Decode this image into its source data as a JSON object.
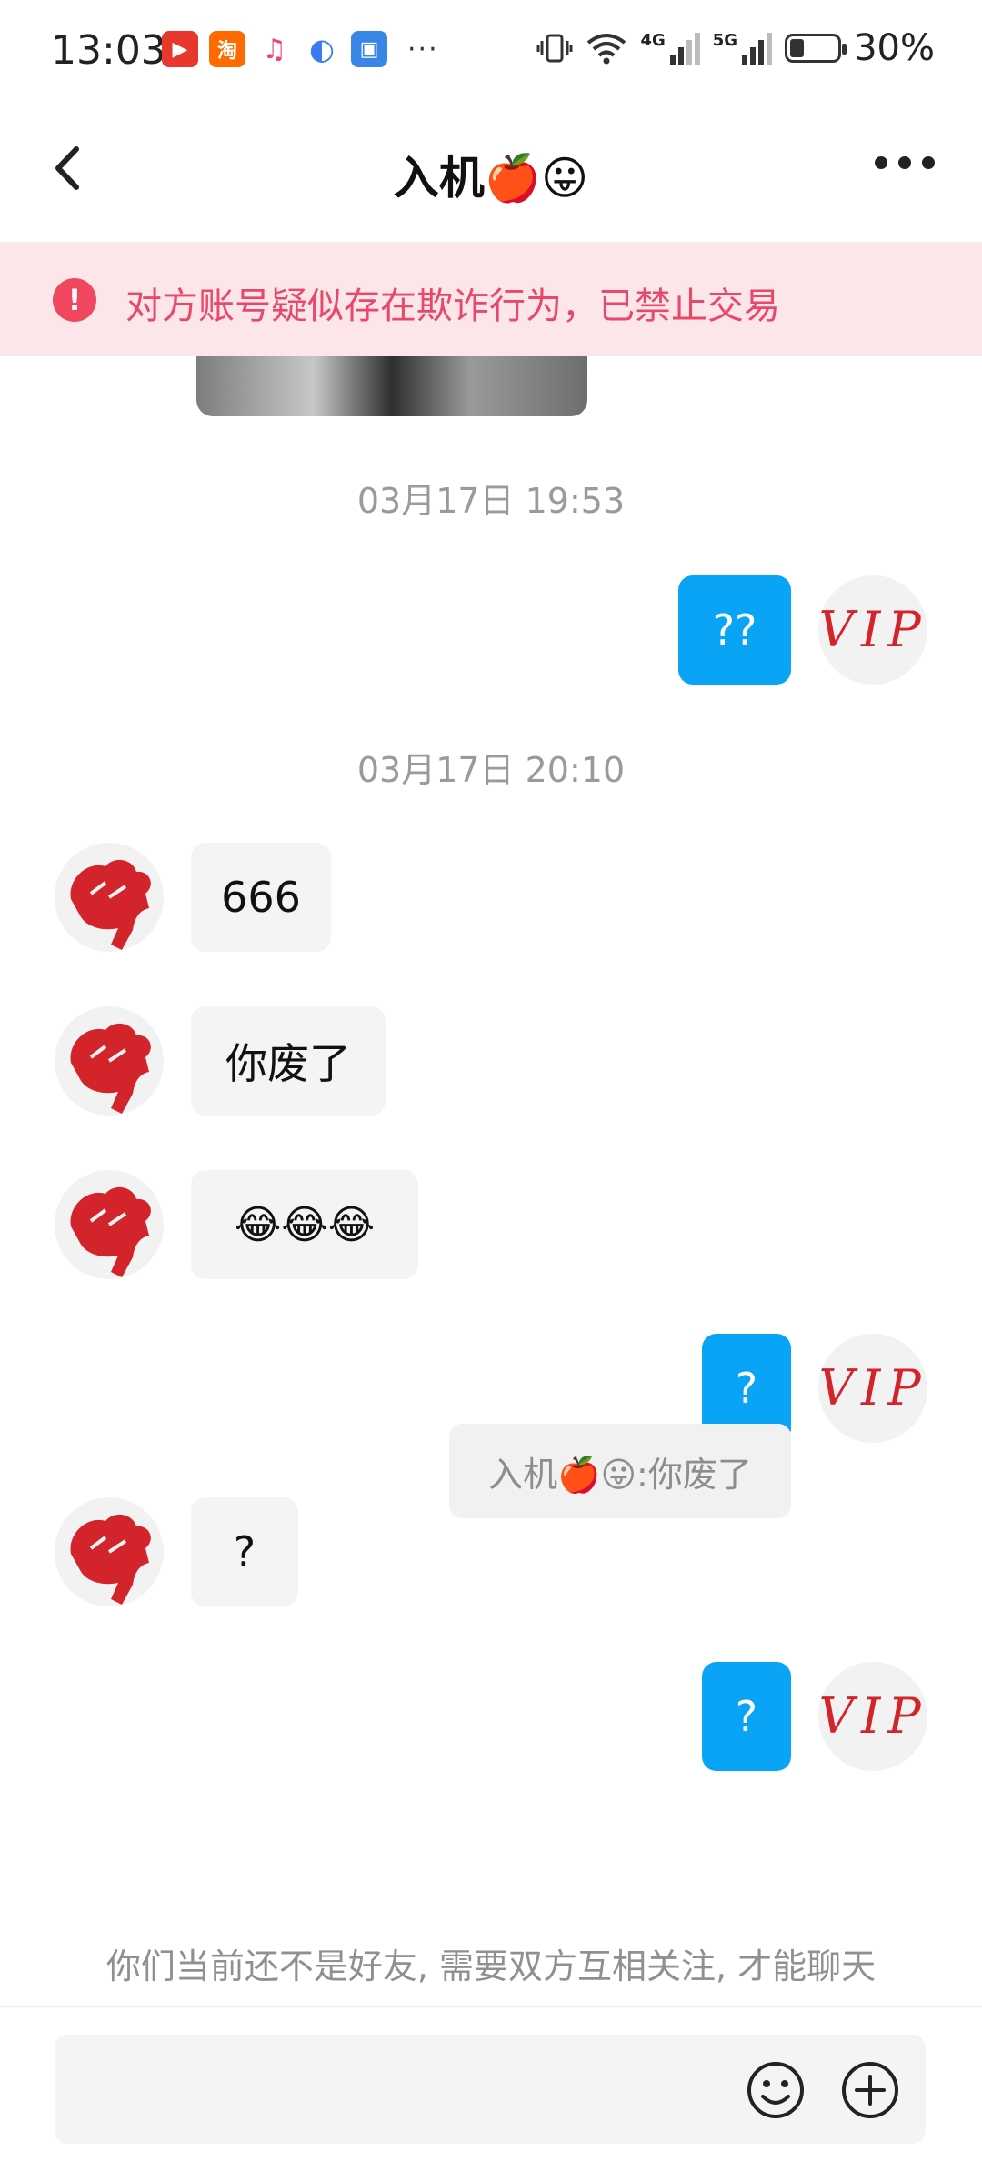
{
  "status_bar": {
    "time": "13:03",
    "left_apps": [
      {
        "name": "video-app-icon",
        "color": "#e8372c",
        "glyph": "▶"
      },
      {
        "name": "taobao-icon",
        "color": "#ff6a00",
        "glyph": "淘"
      },
      {
        "name": "music-icon",
        "color": "#ffffff",
        "glyph": "♫"
      },
      {
        "name": "browser-icon",
        "color": "#3a7bf0",
        "glyph": "◐"
      },
      {
        "name": "security-icon",
        "color": "#3a86e6",
        "glyph": "▣"
      }
    ],
    "overflow": "···",
    "network_4g": "4G",
    "network_5g": "5G",
    "battery": "30%",
    "battery_level": 0.3
  },
  "header": {
    "title": "入机🍎😛"
  },
  "warning": {
    "icon": "!",
    "text": "对方账号疑似存在欺诈行为，已禁止交易"
  },
  "timestamps": [
    "03月17日 19:53",
    "03月17日 20:10"
  ],
  "messages": {
    "m1": "??",
    "m2": "666",
    "m3": "你废了",
    "m4": "😂😂😂",
    "m5": "?",
    "m6": "?",
    "m7": "?"
  },
  "vip_avatar_text": "VIP",
  "quote": {
    "text": "入机🍎😛:你废了"
  },
  "friend_note": "你们当前还不是好友, 需要双方互相关注, 才能聊天",
  "colors": {
    "outgoing_bubble": "#0aa4f6",
    "incoming_bubble": "#f4f4f4",
    "warning_bg": "#fde6e9",
    "warning_text": "#e8486a",
    "avatar_red": "#d3242b"
  }
}
